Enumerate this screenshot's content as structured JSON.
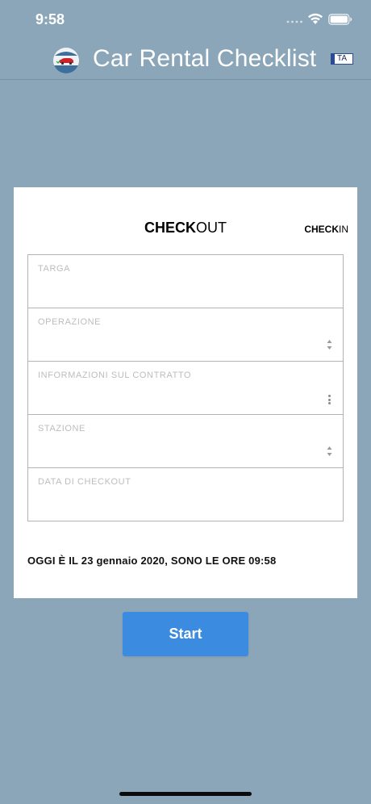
{
  "status_bar": {
    "time": "9:58"
  },
  "nav": {
    "title": "Car Rental Checklist",
    "lang_badge": "TA"
  },
  "tabs": {
    "checkout_bold": "CHECK",
    "checkout_light": "OUT",
    "checkin_bold": "CHECK",
    "checkin_light": "IN"
  },
  "form": {
    "fields": [
      {
        "label": "TARGA"
      },
      {
        "label": "OPERAZIONE"
      },
      {
        "label": "INFORMAZIONI SUL CONTRATTO"
      },
      {
        "label": "STAZIONE"
      },
      {
        "label": "DATA DI CHECKOUT"
      }
    ]
  },
  "date_note": "OGGI È IL 23 gennaio 2020, SONO LE ORE 09:58",
  "start_button": {
    "label": "Start"
  },
  "colors": {
    "background": "#8ba6b8",
    "button": "#3b8be0"
  }
}
